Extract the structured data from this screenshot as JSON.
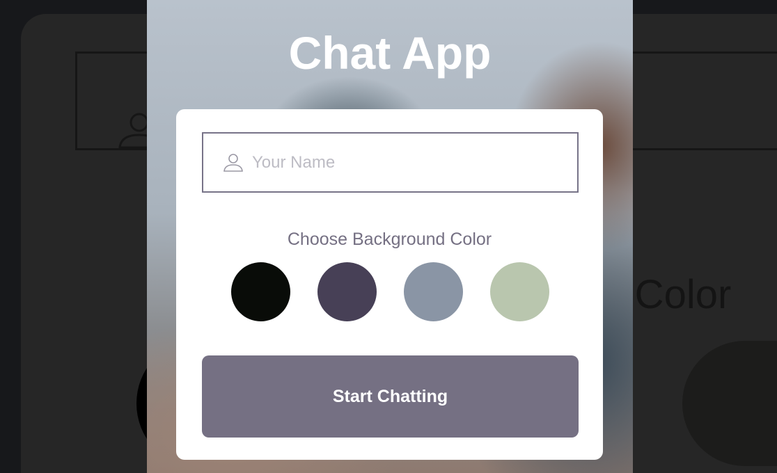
{
  "app": {
    "title": "Chat App"
  },
  "form": {
    "name_placeholder": "Your Name",
    "name_value": "",
    "color_label": "Choose Background Color",
    "colors": [
      "#090C08",
      "#474056",
      "#8A95A5",
      "#B9C6AE"
    ],
    "start_label": "Start Chatting"
  },
  "theme": {
    "accent": "#757083"
  }
}
